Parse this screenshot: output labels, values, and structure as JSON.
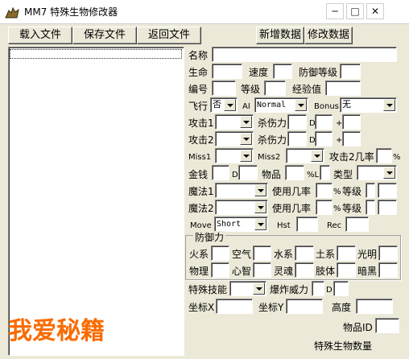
{
  "window": {
    "title": "MM7 特殊生物修改器",
    "controls": {
      "minimize": "▢",
      "maximize": "▢",
      "close": "✕"
    }
  },
  "toolbar": {
    "load": "载入文件",
    "save": "保存文件",
    "back": "返回文件",
    "add": "新增数据",
    "modify": "修改数据"
  },
  "labels": {
    "name": "名称",
    "hp": "生命",
    "speed": "速度",
    "armor": "防御等级",
    "id": "编号",
    "level": "等级",
    "exp": "经验值",
    "fly": "飞行",
    "ai": "AI",
    "bonus": "Bonus",
    "attack1": "攻击1",
    "damage1": "杀伤力",
    "d1": "D",
    "plus1": "+",
    "attack2": "攻击2",
    "damage2": "杀伤力",
    "d2": "D",
    "plus2": "+",
    "miss1": "Miss1",
    "miss2": "Miss2",
    "attack2chance": "攻击2几率",
    "pct": "%",
    "gold": "金钱",
    "d3": "D",
    "item": "物品",
    "pctL": "%L",
    "type": "类型",
    "magic1": "魔法1",
    "userate1": "使用几率",
    "pct2": "%",
    "level2": "等级",
    "magic2": "魔法2",
    "userate2": "使用几率",
    "pct3": "%",
    "level3": "等级",
    "move": "Move",
    "hst": "Hst",
    "rec": "Rec",
    "resist_group": "防御力",
    "fire": "火系",
    "air": "空气",
    "water": "水系",
    "earth": "土系",
    "light": "光明",
    "physical": "物理",
    "mind": "心智",
    "spirit": "灵魂",
    "body": "肢体",
    "dark": "暗黑",
    "special": "特殊技能",
    "explosion": "爆炸威力",
    "d4": "D",
    "coordx": "坐标X",
    "coordy": "坐标Y",
    "height": "高度",
    "itemid": "物品ID"
  },
  "values": {
    "fly": "否",
    "ai": "Normal",
    "bonus": "无",
    "move": "Short"
  },
  "watermark": "我爱秘籍",
  "status": "特殊生物数量"
}
